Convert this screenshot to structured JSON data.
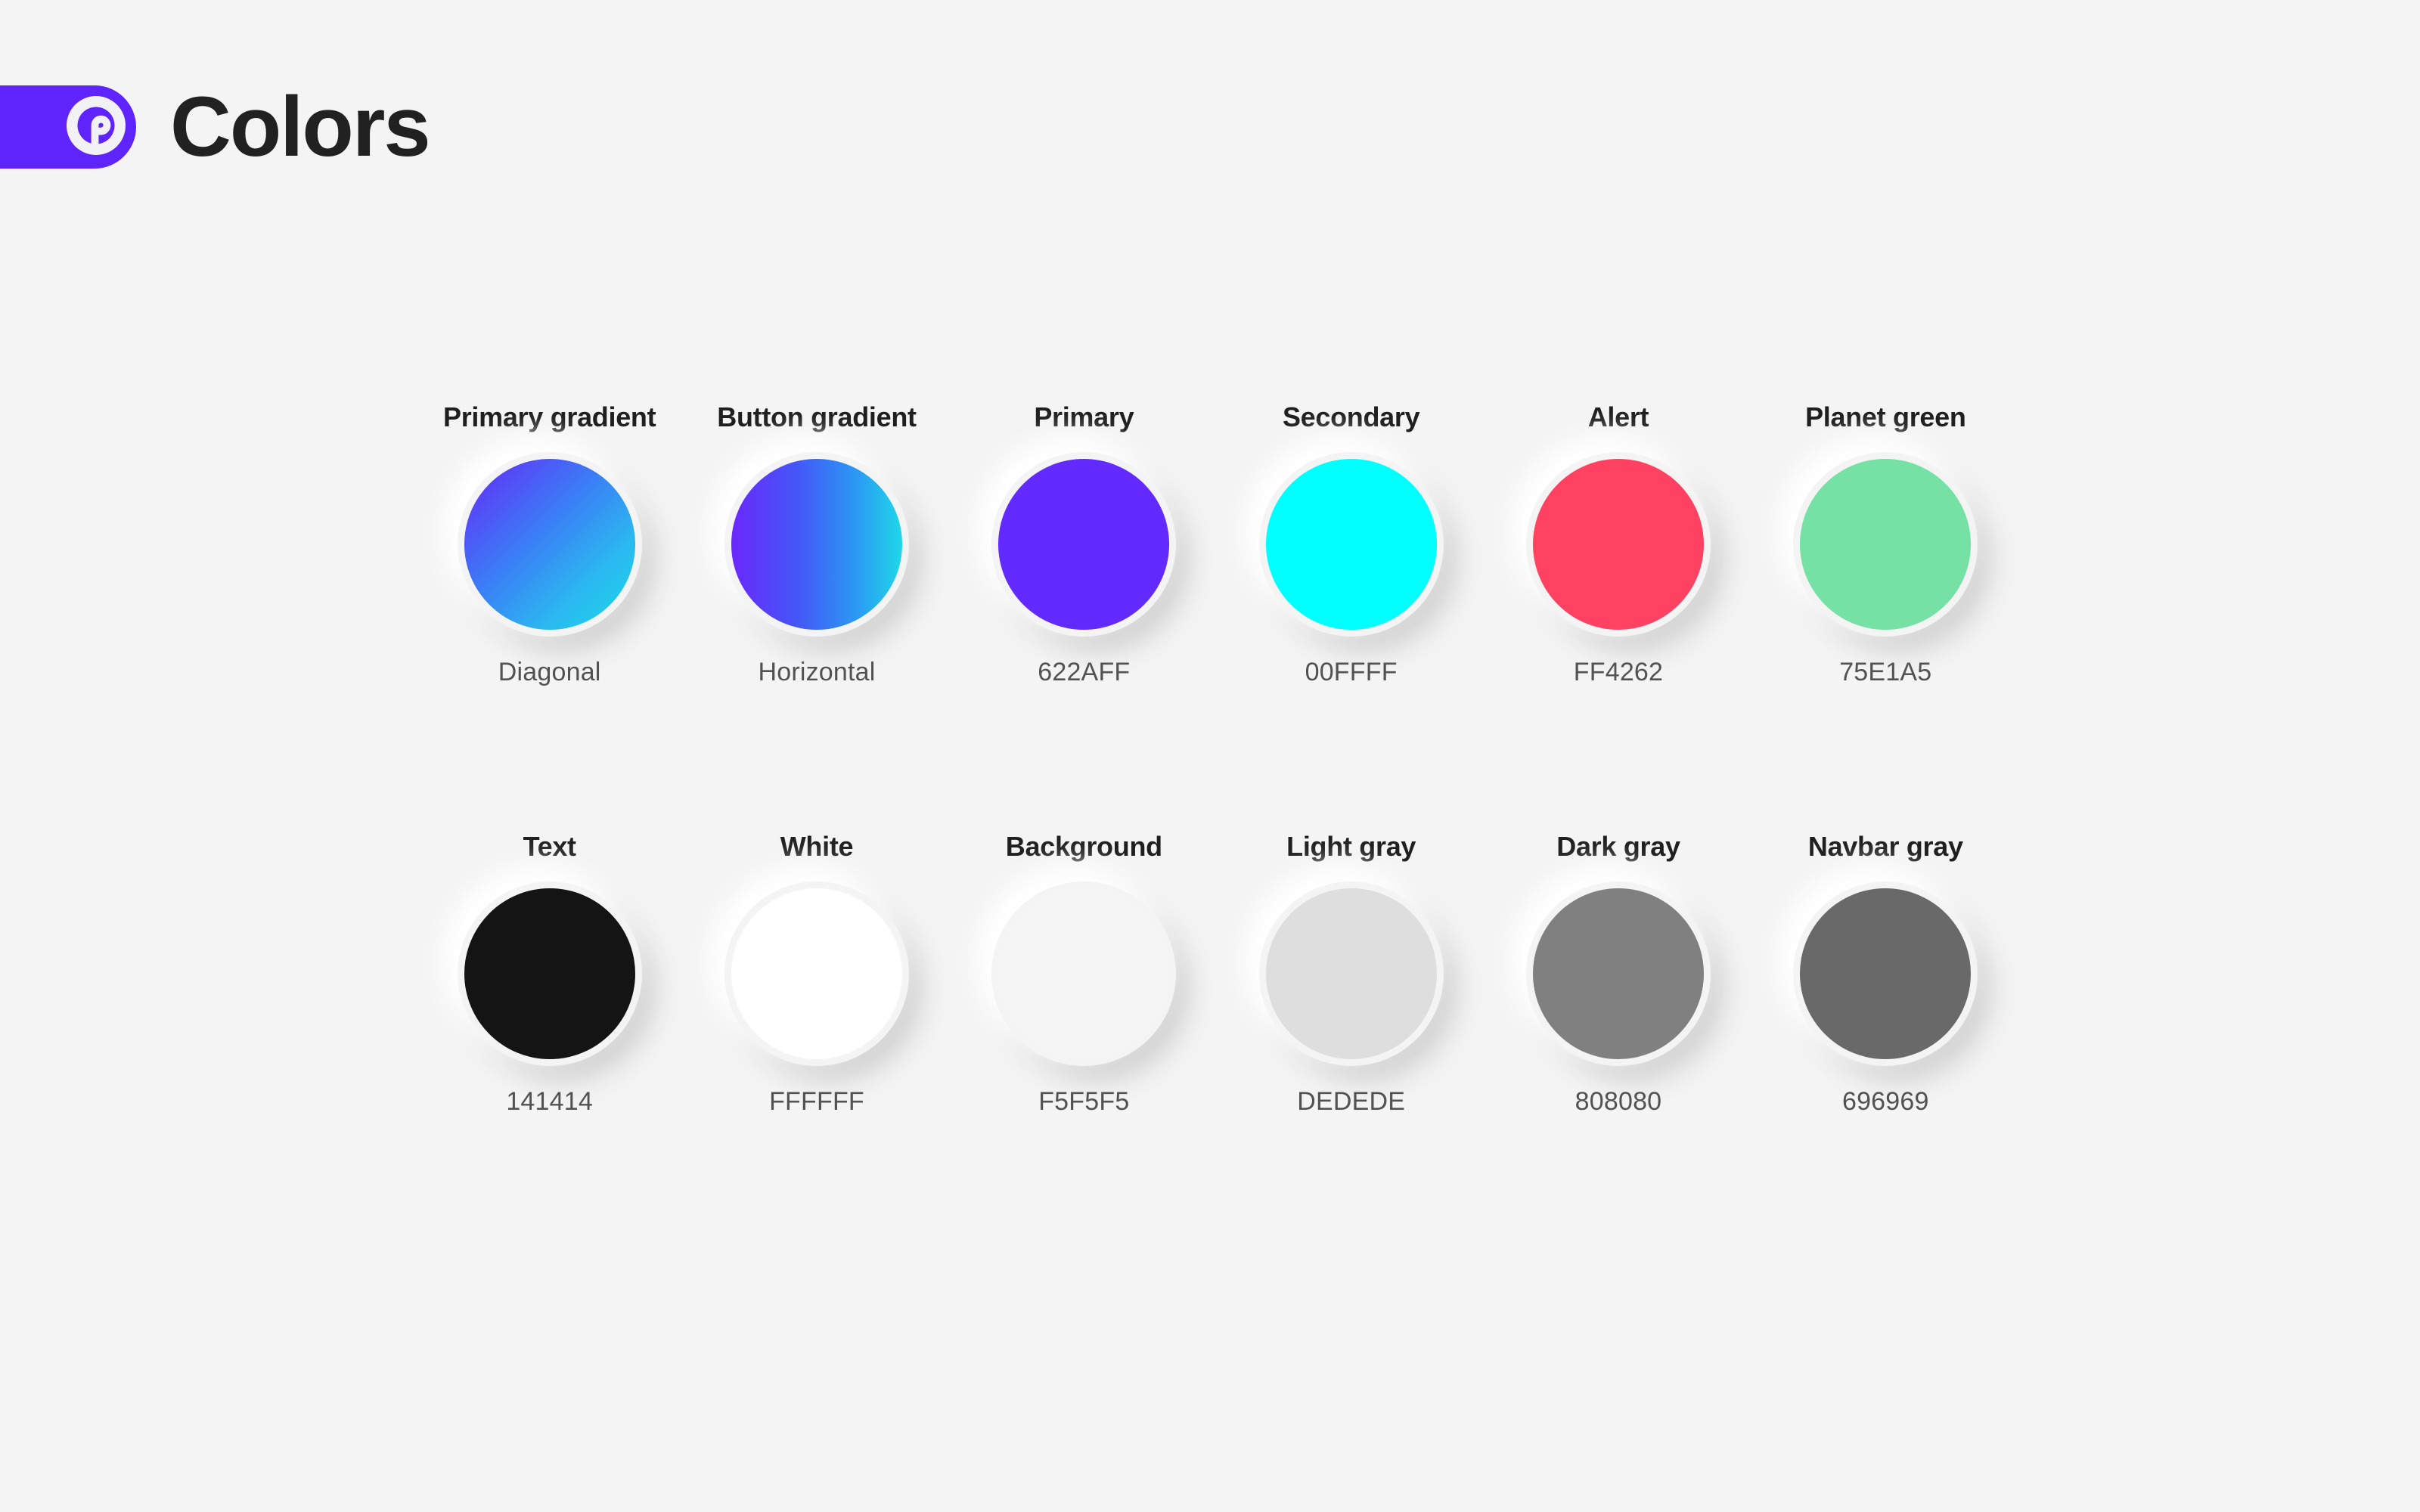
{
  "header": {
    "title": "Colors",
    "logo_icon": "planet-p-logo-icon",
    "badge_color": "#5F24FB"
  },
  "page": {
    "background_color": "#F4F4F4",
    "text_color": "#141414"
  },
  "palette": {
    "rows": [
      {
        "swatches": [
          {
            "label": "Primary gradient",
            "value": "Diagonal",
            "type": "gradient",
            "css": "linear-gradient(135deg, #6726F6 0%, #3B7CF6 42%, #2BB7F0 72%, #18DCE8 100%)"
          },
          {
            "label": "Button gradient",
            "value": "Horizontal",
            "type": "gradient",
            "css": "linear-gradient(90deg, #6A28FB 0%, #4456F8 38%, #2A9BF3 74%, #1FD8E9 100%)"
          },
          {
            "label": "Primary",
            "value": "622AFF",
            "type": "solid",
            "css": "#622AFF"
          },
          {
            "label": "Secondary",
            "value": "00FFFF",
            "type": "solid",
            "css": "#00FFFF"
          },
          {
            "label": "Alert",
            "value": "FF4262",
            "type": "solid",
            "css": "#FF4262"
          },
          {
            "label": "Planet green",
            "value": "75E1A5",
            "type": "solid",
            "css": "#75E1A5"
          }
        ]
      },
      {
        "swatches": [
          {
            "label": "Text",
            "value": "141414",
            "type": "solid",
            "css": "#141414"
          },
          {
            "label": "White",
            "value": "FFFFFF",
            "type": "solid",
            "css": "#FFFFFF"
          },
          {
            "label": "Background",
            "value": "F5F5F5",
            "type": "solid",
            "css": "#F5F5F5"
          },
          {
            "label": "Light gray",
            "value": "DEDEDE",
            "type": "solid",
            "css": "#DEDEDE"
          },
          {
            "label": "Dark gray",
            "value": "808080",
            "type": "solid",
            "css": "#808080"
          },
          {
            "label": "Navbar gray",
            "value": "696969",
            "type": "solid",
            "css": "#696969"
          }
        ]
      }
    ]
  }
}
